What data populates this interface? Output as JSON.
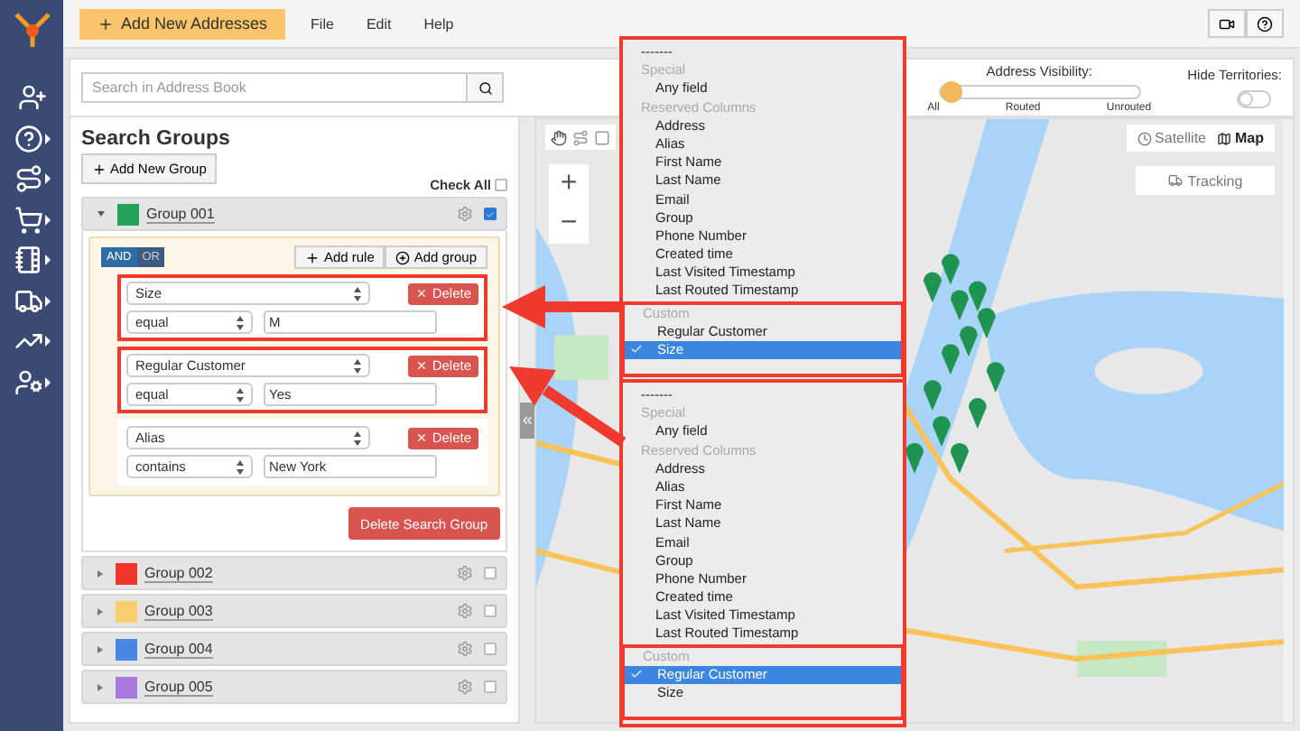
{
  "toolbar": {
    "add_button": "Add New Addresses",
    "menus": [
      "File",
      "Edit",
      "Help"
    ]
  },
  "search": {
    "placeholder": "Search in Address Book"
  },
  "search_groups": {
    "title": "Search Groups",
    "add_group": "Add New Group",
    "check_all": {
      "label": "Check All",
      "checked": false
    },
    "groups": [
      {
        "name": "Group 001",
        "color": "#27a25a",
        "expanded": true,
        "checked": true,
        "conjunctions": [
          {
            "label": "AND",
            "selected": true
          },
          {
            "label": "OR",
            "selected": false
          }
        ],
        "add_rule": "Add rule",
        "add_subgroup": "Add group",
        "delete_group": "Delete Search Group",
        "rules": [
          {
            "field": "Size",
            "operator": "equal",
            "value": "M",
            "delete": "Delete",
            "highlighted": true
          },
          {
            "field": "Regular Customer",
            "operator": "equal",
            "value": "Yes",
            "delete": "Delete",
            "highlighted": true
          },
          {
            "field": "Alias",
            "operator": "contains",
            "value": "New York",
            "delete": "Delete",
            "highlighted": false
          }
        ]
      },
      {
        "name": "Group 002",
        "color": "#f2362a",
        "expanded": false,
        "checked": false
      },
      {
        "name": "Group 003",
        "color": "#f8cf6c",
        "expanded": false,
        "checked": false
      },
      {
        "name": "Group 004",
        "color": "#4a86e6",
        "expanded": false,
        "checked": false
      },
      {
        "name": "Group 005",
        "color": "#a779dd",
        "expanded": false,
        "checked": false
      }
    ]
  },
  "map": {
    "visibility": {
      "label": "Address Visibility:",
      "level": 0,
      "ticks": [
        "All",
        "Routed",
        "Unrouted"
      ]
    },
    "hide_territories": {
      "label": "Hide Territories:",
      "on": false
    },
    "map_types": [
      {
        "label": "Satellite",
        "selected": false
      },
      {
        "label": "Map",
        "selected": true
      }
    ],
    "tracking": "Tracking",
    "zoom_in": "+",
    "zoom_out": "−"
  },
  "dropdowns": [
    {
      "sections": [
        {
          "highlighted": false,
          "items": [
            {
              "kind": "separator",
              "label": "-------"
            },
            {
              "kind": "header",
              "label": "Special"
            },
            {
              "kind": "option",
              "label": "Any field",
              "selected": false
            },
            {
              "kind": "header",
              "label": "Reserved Columns"
            },
            {
              "kind": "option",
              "label": "Address",
              "selected": false
            },
            {
              "kind": "option",
              "label": "Alias",
              "selected": false
            },
            {
              "kind": "option",
              "label": "First Name",
              "selected": false
            },
            {
              "kind": "option",
              "label": "Last Name",
              "selected": false
            },
            {
              "kind": "option",
              "label": "Email",
              "selected": false
            },
            {
              "kind": "option",
              "label": "Group",
              "selected": false
            },
            {
              "kind": "option",
              "label": "Phone Number",
              "selected": false
            },
            {
              "kind": "option",
              "label": "Created time",
              "selected": false
            },
            {
              "kind": "option",
              "label": "Last Visited Timestamp",
              "selected": false
            },
            {
              "kind": "option",
              "label": "Last Routed Timestamp",
              "selected": false
            }
          ]
        },
        {
          "highlighted": true,
          "items": [
            {
              "kind": "header",
              "label": "Custom"
            },
            {
              "kind": "option",
              "label": "Regular Customer",
              "selected": false
            },
            {
              "kind": "option",
              "label": "Size",
              "selected": true
            }
          ]
        }
      ]
    },
    {
      "sections": [
        {
          "highlighted": false,
          "items": [
            {
              "kind": "separator",
              "label": "-------"
            },
            {
              "kind": "header",
              "label": "Special"
            },
            {
              "kind": "option",
              "label": "Any field",
              "selected": false
            },
            {
              "kind": "header",
              "label": "Reserved Columns"
            },
            {
              "kind": "option",
              "label": "Address",
              "selected": false
            },
            {
              "kind": "option",
              "label": "Alias",
              "selected": false
            },
            {
              "kind": "option",
              "label": "First Name",
              "selected": false
            },
            {
              "kind": "option",
              "label": "Last Name",
              "selected": false
            },
            {
              "kind": "option",
              "label": "Email",
              "selected": false
            },
            {
              "kind": "option",
              "label": "Group",
              "selected": false
            },
            {
              "kind": "option",
              "label": "Phone Number",
              "selected": false
            },
            {
              "kind": "option",
              "label": "Created time",
              "selected": false
            },
            {
              "kind": "option",
              "label": "Last Visited Timestamp",
              "selected": false
            },
            {
              "kind": "option",
              "label": "Last Routed Timestamp",
              "selected": false
            }
          ]
        },
        {
          "highlighted": true,
          "items": [
            {
              "kind": "header",
              "label": "Custom"
            },
            {
              "kind": "option",
              "label": "Regular Customer",
              "selected": true
            },
            {
              "kind": "option",
              "label": "Size",
              "selected": false
            }
          ]
        }
      ]
    }
  ]
}
